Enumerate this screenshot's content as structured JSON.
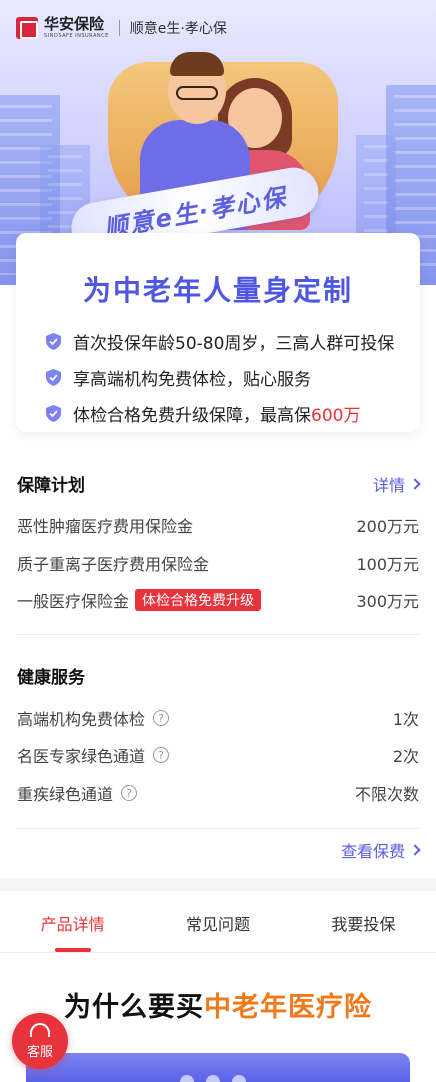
{
  "header": {
    "brand_cn": "华安保险",
    "brand_en": "SINOSAFE INSURANCE",
    "product": "顺意e生·孝心保"
  },
  "hero": {
    "ribbon_text": "顺意e生·孝心保"
  },
  "intro": {
    "title": "为中老年人量身定制",
    "items": [
      {
        "text": "首次投保年龄50-80周岁，三高人群可投保"
      },
      {
        "text": "享高端机构免费体检，贴心服务"
      },
      {
        "text_prefix": "体检合格免费升级保障，最高保",
        "highlight": "600万"
      }
    ]
  },
  "plan": {
    "title": "保障计划",
    "detail_label": "详情",
    "rows": [
      {
        "label": "恶性肿瘤医疗费用保险金",
        "value": "200万元"
      },
      {
        "label": "质子重离子医疗费用保险金",
        "value": "100万元"
      },
      {
        "label": "一般医疗保险金",
        "tag": "体检合格免费升级",
        "value": "300万元"
      }
    ]
  },
  "health": {
    "title": "健康服务",
    "rows": [
      {
        "label": "高端机构免费体检",
        "value": "1次"
      },
      {
        "label": "名医专家绿色通道",
        "value": "2次"
      },
      {
        "label": "重疾绿色通道",
        "value": "不限次数"
      }
    ],
    "premium_link": "查看保费"
  },
  "tabs": [
    {
      "label": "产品详情",
      "active": true
    },
    {
      "label": "常见问题",
      "active": false
    },
    {
      "label": "我要投保",
      "active": false
    }
  ],
  "why": {
    "prefix": "为什么要买",
    "accent": "中老年医疗险"
  },
  "service_button": {
    "label": "客服"
  },
  "colors": {
    "brand_red": "#e8323c",
    "accent_blue": "#5b5fe0",
    "accent_orange": "#f07a1a"
  },
  "icons": [
    "shield-check-icon",
    "chevron-right-icon",
    "help-circle-icon",
    "headset-icon"
  ]
}
